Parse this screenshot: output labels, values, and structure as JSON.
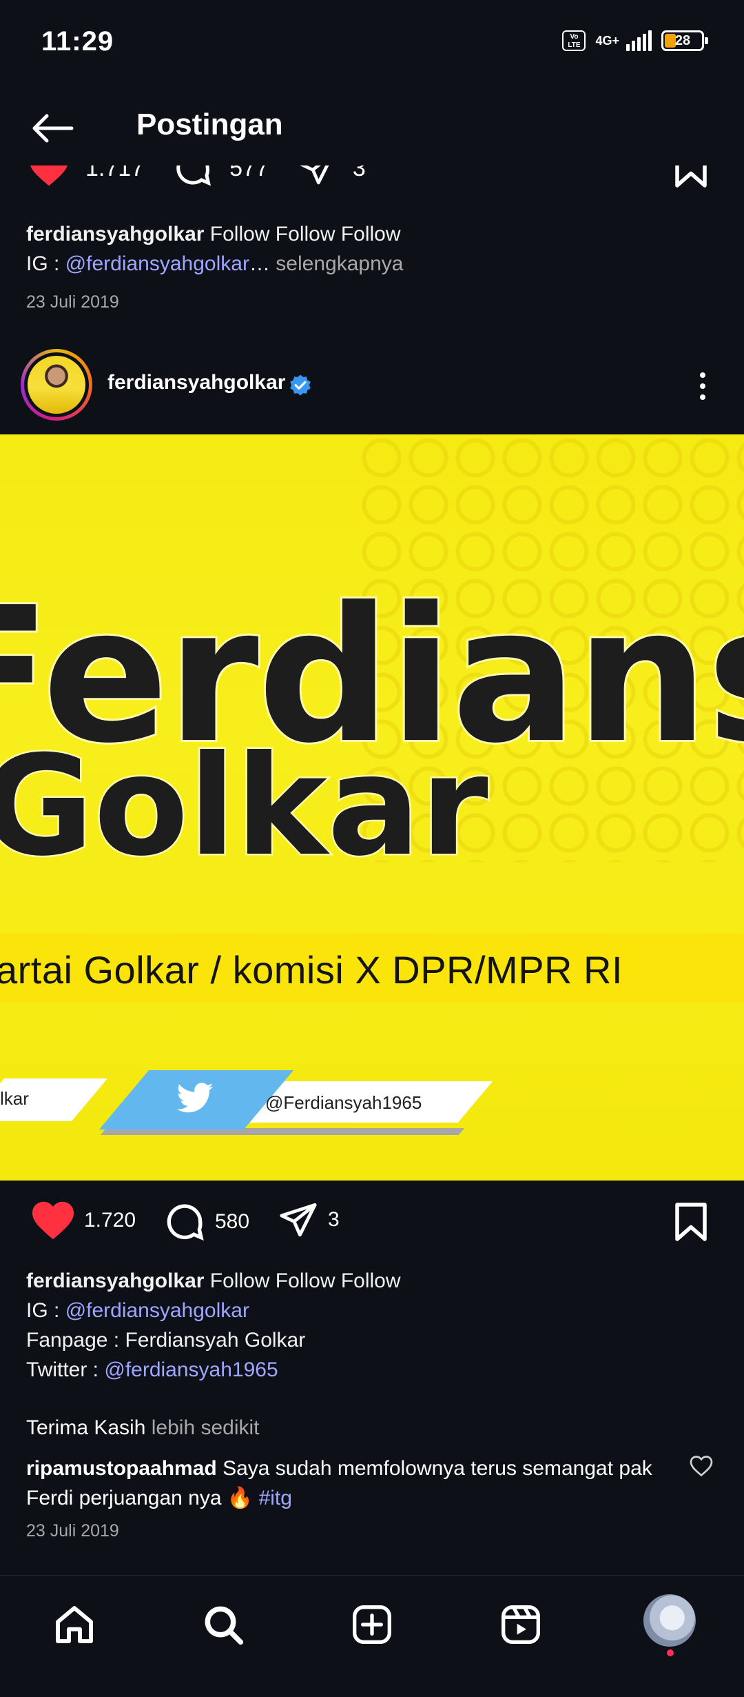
{
  "status_bar": {
    "time": "11:29",
    "volte": "Vo LTE",
    "network": "4G+",
    "battery": "28"
  },
  "header": {
    "title": "Postingan"
  },
  "previous_post": {
    "likes": "1.717",
    "comments": "577",
    "shares": "3",
    "username": "ferdiansyahgolkar",
    "caption_text": "Follow Follow Follow",
    "ig_label": "IG : ",
    "ig_handle": "@ferdiansyahgolkar",
    "ellipsis": "…",
    "more": "selengkapnya",
    "date": "23 Juli 2019"
  },
  "post": {
    "username": "ferdiansyahgolkar",
    "verified": true,
    "image": {
      "name_text": "Ferdiansyah",
      "party_text": "Golkar",
      "subtitle": "artai Golkar / komisi X DPR/MPR RI",
      "left_tag": "lkar",
      "twitter_handle": "@Ferdiansyah1965"
    },
    "likes": "1.720",
    "comments": "580",
    "shares": "3",
    "caption": {
      "username": "ferdiansyahgolkar",
      "text": "Follow Follow Follow",
      "ig_label": "IG : ",
      "ig_handle": "@ferdiansyahgolkar",
      "fanpage": "Fanpage : Ferdiansyah Golkar",
      "twitter_label": "Twitter : ",
      "twitter_handle": "@ferdiansyah1965",
      "thanks": "Terima Kasih",
      "less": "lebih sedikit"
    },
    "comment": {
      "username": "ripamustopaahmad",
      "text": "Saya sudah memfolownya terus semangat pak Ferdi perjuangan nya 🔥",
      "hashtag": "#itg"
    },
    "date": "23 Juli 2019"
  },
  "colors": {
    "background": "#0d1017",
    "link": "#9ea7ff",
    "like": "#ff3040",
    "image_yellow": "#f5ea12"
  },
  "bottom_nav": {
    "items": [
      "home-icon",
      "search-icon",
      "create-icon",
      "reels-icon",
      "profile-avatar"
    ]
  }
}
